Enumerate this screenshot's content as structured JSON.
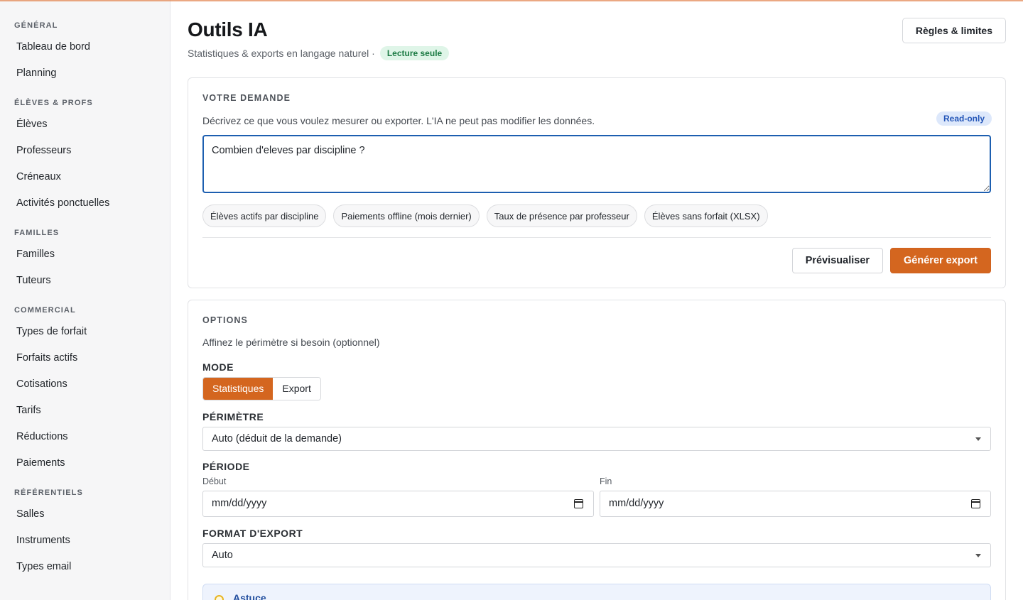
{
  "sidebar": {
    "sections": [
      {
        "title": "GÉNÉRAL",
        "items": [
          "Tableau de bord",
          "Planning"
        ]
      },
      {
        "title": "ÉLÈVES & PROFS",
        "items": [
          "Élèves",
          "Professeurs",
          "Créneaux",
          "Activités ponctuelles"
        ]
      },
      {
        "title": "FAMILLES",
        "items": [
          "Familles",
          "Tuteurs"
        ]
      },
      {
        "title": "COMMERCIAL",
        "items": [
          "Types de forfait",
          "Forfaits actifs",
          "Cotisations",
          "Tarifs",
          "Réductions",
          "Paiements"
        ]
      },
      {
        "title": "RÉFÉRENTIELS",
        "items": [
          "Salles",
          "Instruments",
          "Types email"
        ]
      }
    ]
  },
  "header": {
    "title": "Outils IA",
    "subtitle": "Statistiques & exports en langage naturel ·",
    "badge": "Lecture seule",
    "rules_button": "Règles & limites"
  },
  "request": {
    "label": "VOTRE DEMANDE",
    "description": "Décrivez ce que vous voulez mesurer ou exporter. L'IA ne peut pas modifier les données.",
    "badge": "Read-only",
    "query_value": "Combien d'eleves par discipline ?",
    "suggestions": [
      "Élèves actifs par discipline",
      "Paiements offline (mois dernier)",
      "Taux de présence par professeur",
      "Élèves sans forfait (XLSX)"
    ],
    "preview_button": "Prévisualiser",
    "generate_button": "Générer export"
  },
  "options": {
    "label": "OPTIONS",
    "description": "Affinez le périmètre si besoin (optionnel)",
    "mode_label": "MODE",
    "modes": [
      "Statistiques",
      "Export"
    ],
    "active_mode": "Statistiques",
    "scope_label": "PÉRIMÈTRE",
    "scope_value": "Auto (déduit de la demande)",
    "period_label": "PÉRIODE",
    "start_label": "Début",
    "end_label": "Fin",
    "start_value": "mm/dd/yyyy",
    "end_value": "mm/dd/yyyy",
    "format_label": "FORMAT D'EXPORT",
    "format_value": "Auto",
    "tip_title": "Astuce"
  },
  "colors": {
    "accent": "#d4661f",
    "focus": "#1d5fb0",
    "badge_green_bg": "#dff5e8",
    "badge_blue_bg": "#dde8fb"
  }
}
